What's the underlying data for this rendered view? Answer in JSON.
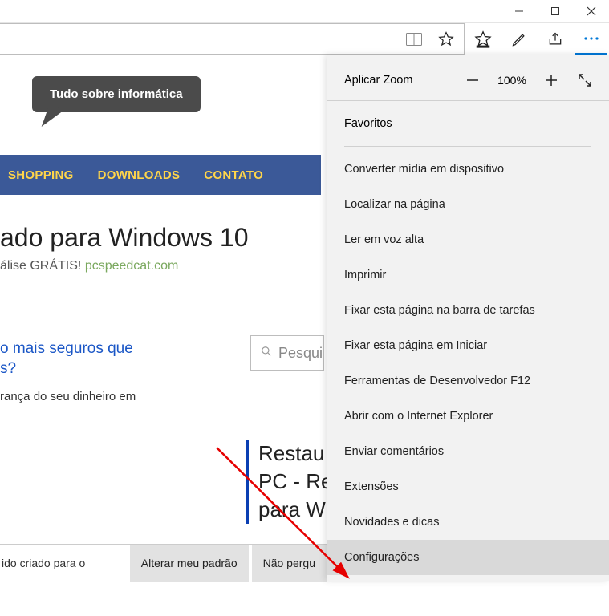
{
  "window": {
    "minimize": "—",
    "maximize": "❐",
    "close": "✕"
  },
  "logo_bubble": "Tudo sobre informática",
  "nav": {
    "shopping": "SHOPPING",
    "downloads": "DOWNLOADS",
    "contato": "CONTATO"
  },
  "ad": {
    "headline": "ado para Windows 10",
    "subline_prefix": "álise GRÁTIS! ",
    "subline_url": "pcspeedcat.com"
  },
  "article1": {
    "line1": "o mais seguros que",
    "line2": "s?",
    "sub": "rança do seu dinheiro em"
  },
  "search_placeholder": "Pesquis",
  "article2": {
    "l1": "Restau",
    "l2": "PC - Re",
    "l3": "para W"
  },
  "bottombar": {
    "text": "ido criado para o",
    "btn_change": "Alterar meu padrão",
    "btn_dont": "Não pergu"
  },
  "menu": {
    "zoom_label": "Aplicar Zoom",
    "zoom_pct": "100%",
    "favorites": "Favoritos",
    "items": [
      "Converter mídia em dispositivo",
      "Localizar na página",
      "Ler em voz alta",
      "Imprimir",
      "Fixar esta página na barra de tarefas",
      "Fixar esta página em Iniciar",
      "Ferramentas de Desenvolvedor F12",
      "Abrir com o Internet Explorer",
      "Enviar comentários",
      "Extensões",
      "Novidades e dicas",
      "Configurações"
    ],
    "hover_index": 11
  }
}
